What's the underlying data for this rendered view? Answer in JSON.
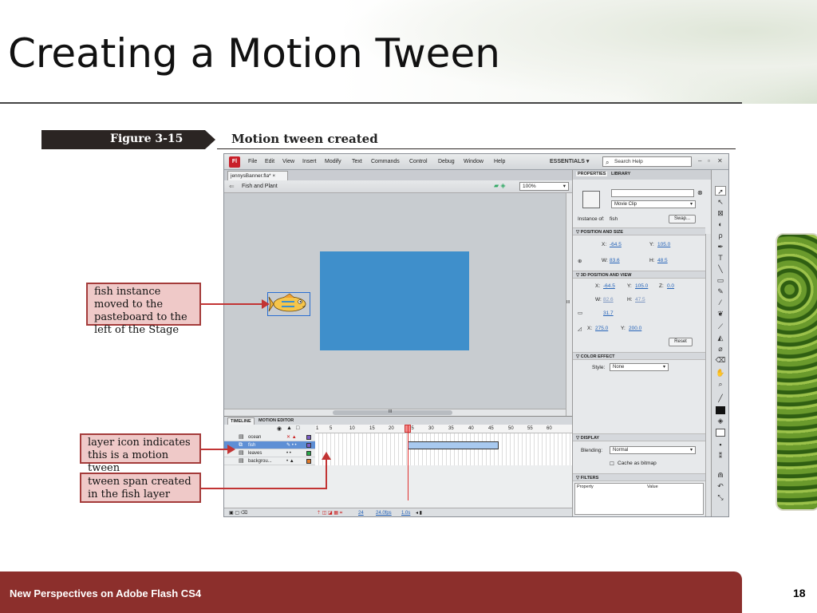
{
  "slide": {
    "title": "Creating a Motion Tween",
    "footer": "New Perspectives on Adobe Flash CS4",
    "page_number": "18"
  },
  "figure": {
    "label": "Figure 3-15",
    "caption": "Motion tween created"
  },
  "app": {
    "logo": "Fl",
    "menu": [
      "File",
      "Edit",
      "View",
      "Insert",
      "Modify",
      "Text",
      "Commands",
      "Control",
      "Debug",
      "Window",
      "Help"
    ],
    "workspace": "ESSENTIALS ▾",
    "search_placeholder": "Search Help",
    "doc_tab": "jennysBanner.fla* ×",
    "breadcrumb": "Fish and Plant",
    "zoom": "100%",
    "hscroll_mark": "III",
    "vscroll_mark": "III"
  },
  "timeline": {
    "tabs": [
      "TIMELINE",
      "MOTION EDITOR"
    ],
    "ruler": [
      "1",
      "5",
      "10",
      "15",
      "20",
      "25",
      "30",
      "35",
      "40",
      "45",
      "50",
      "55",
      "60"
    ],
    "layers": [
      {
        "name": "ocean",
        "color": "#7a5cc7"
      },
      {
        "name": "fish",
        "color": "#7a5cc7"
      },
      {
        "name": "leaves",
        "color": "#29a84a"
      },
      {
        "name": "backgrou...",
        "color": "#e07a2a"
      }
    ],
    "status_frame": "24",
    "status_fps": "24.0fps",
    "status_time": "1.0s"
  },
  "properties": {
    "tabs": [
      "PROPERTIES",
      "LIBRARY"
    ],
    "symbol_type": "Movie Clip",
    "instance_of_label": "Instance of:",
    "instance_of": "fish",
    "swap": "Swap...",
    "section_position": "POSITION AND SIZE",
    "x_label": "X:",
    "x": "-64.5",
    "y_label": "Y:",
    "y": "105.0",
    "w_label": "W:",
    "w": "83.6",
    "h_label": "H:",
    "h": "48.5",
    "section_3d": "3D POSITION AND VIEW",
    "x3d": "-64.5",
    "y3d": "105.0",
    "z_label": "Z:",
    "z3d": "0.0",
    "w3d": "82.6",
    "h3d": "47.5",
    "persp": "31.7",
    "vx": "275.0",
    "vy": "200.0",
    "reset": "Reset",
    "section_color": "COLOR EFFECT",
    "style_label": "Style:",
    "style": "None",
    "section_display": "DISPLAY",
    "blending_label": "Blending:",
    "blending": "Normal",
    "cache": "Cache as bitmap",
    "section_filters": "FILTERS",
    "col_property": "Property",
    "col_value": "Value"
  },
  "callouts": {
    "fish_moved": "fish instance moved to the pasteboard to the left of the Stage",
    "layer_icon": "layer icon indicates this is a motion tween",
    "tween_span": "tween span created in the fish layer"
  },
  "colors": {
    "stage": "#3f8fcb",
    "footer": "#8c2f2c",
    "callout_border": "#a43b3a",
    "callout_fill": "#efc9c8",
    "tween": "#a8c9ef"
  }
}
